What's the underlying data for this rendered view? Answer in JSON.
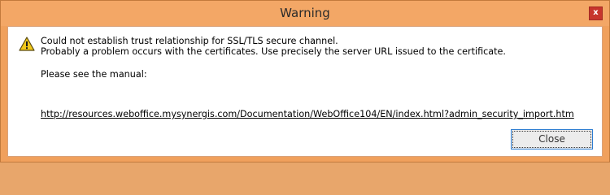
{
  "dialog": {
    "title": "Warning",
    "close_icon": "close-icon",
    "close_glyph": "x",
    "icon": "warning-icon",
    "message_line1": "Could not establish trust relationship for SSL/TLS secure channel.",
    "message_line2": "Probably a problem occurs with the certificates. Use precisely the server URL issued to the certificate.",
    "manual_label": "Please see the manual:",
    "manual_link": "http://resources.weboffice.mysynergis.com/Documentation/WebOffice104/EN/index.html?admin_security_import.htm",
    "close_button_label": "Close"
  },
  "colors": {
    "titlebar": "#f3a766",
    "close_button_bg": "#c7352c",
    "focus_border": "#2c7cd1",
    "warning_yellow": "#f2c81a"
  }
}
